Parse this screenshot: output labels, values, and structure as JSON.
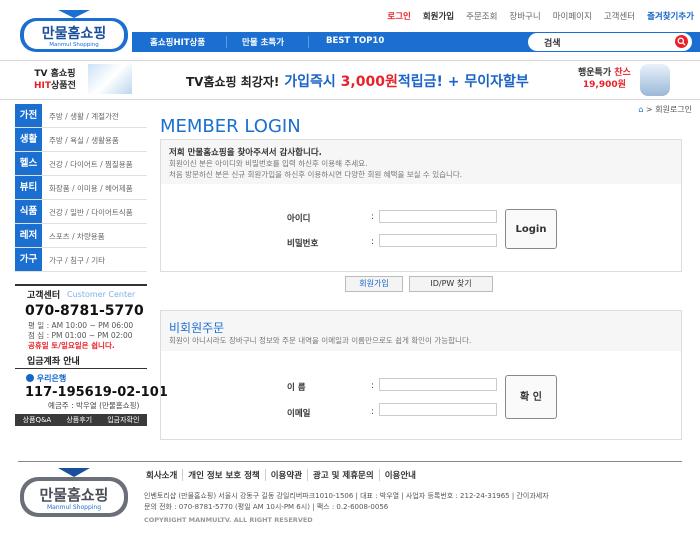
{
  "header": {
    "top_links": [
      "로그인",
      "회원가입",
      "주문조회",
      "장바구니",
      "마이페이지",
      "고객센터",
      "즐겨찾기추가"
    ],
    "logo_text": "만물홈쇼핑",
    "logo_sub": "Manmul Shopping"
  },
  "nav": {
    "items": [
      "홈쇼핑HIT상품",
      "만물 초특가",
      "BEST TOP10"
    ],
    "search_placeholder": "검색"
  },
  "banner": {
    "tv_line1": "TV 홈쇼핑",
    "tv_line2_red": "HIT",
    "tv_line2_rest": "상품전",
    "promo_a": "TV홈쇼핑 최강자!",
    "promo_b": "가입즉시",
    "promo_c": "3,000원",
    "promo_d": "적립금! + 무이자할부",
    "lucky_a": "행운특가",
    "lucky_b": "찬스",
    "lucky_price": "19,900원"
  },
  "sidebar": {
    "categories": [
      {
        "tag": "가전",
        "text": "주방 / 생활 / 계절가전"
      },
      {
        "tag": "생활",
        "text": "주방 / 욕실 / 생활용품"
      },
      {
        "tag": "헬스",
        "text": "건강 / 다이어트 / 찜질용품"
      },
      {
        "tag": "뷰티",
        "text": "화장품 / 이미용 / 헤어제품"
      },
      {
        "tag": "식품",
        "text": "건강 / 일반 / 다이어트식품"
      },
      {
        "tag": "레저",
        "text": "스포츠 / 차량용품"
      },
      {
        "tag": "가구",
        "text": "가구 / 침구 / 기타"
      }
    ],
    "cs_title": "고객센터",
    "cs_eng": "Customer Center",
    "phone": "070-8781-5770",
    "hours1": "평   일 : AM 10:00 ~ PM 06:00",
    "hours2": "점   심 : PM 01:00 ~ PM 02:00",
    "hours3": "공휴일 토/일요일은 쉽니다.",
    "bank_title": "입금계좌 안내",
    "bank_name": "우리은행",
    "account": "117-195619-02-101",
    "holder": "예금주 : 박우열 (만물홈쇼핑)",
    "quick": [
      "상품Q&A",
      "상품후기",
      "입금자확인"
    ]
  },
  "breadcrumb": "회원로그인",
  "login": {
    "title": "MEMBER LOGIN",
    "greet_title": "저희 만물홈쇼핑을 찾아주셔서 감사합니다.",
    "greet_a": "회원이신 분은 아이디와 비밀번호를 입력 하신후 이용해 주세요.",
    "greet_b": "처음 방문하신 분은 신규 회원가입을 하신후 이용하시면 다양한 회원 혜택을 보실 수 있습니다.",
    "id_label": "아이디",
    "pw_label": "비밀번호",
    "colon": ":",
    "login_button": "Login",
    "join_button": "회원가입",
    "find_button": "ID/PW 찾기"
  },
  "guest": {
    "title": "비회원주문",
    "desc": "회원이 아니시라도 장바구니 정보와 주문 내역을 이메일과 이름만으로도 쉽게 확인이 가능합니다.",
    "name_label": "이 름",
    "email_label": "이메일",
    "confirm_button": "확 인"
  },
  "footer": {
    "nav": [
      "회사소개",
      "개인 정보 보호 정책",
      "이용약관",
      "광고 및 제휴문의",
      "이용안내"
    ],
    "info1": "인벤토리샵 (만물홈쇼핑)  서울시 강동구 길동 강일리버파크1010-1506  |  대표 : 박우열  |  사업자 등록번호 : 212-24-31965  |  간이과세자",
    "info2": "문의 전화 : 070-8781-5770 (평일 AM 10시-PM 6시)  |  팩스 : 0.2-6008-0056",
    "copyright": "COPYRIGHT MANMULTV. ALL RIGHT RESERVED"
  }
}
